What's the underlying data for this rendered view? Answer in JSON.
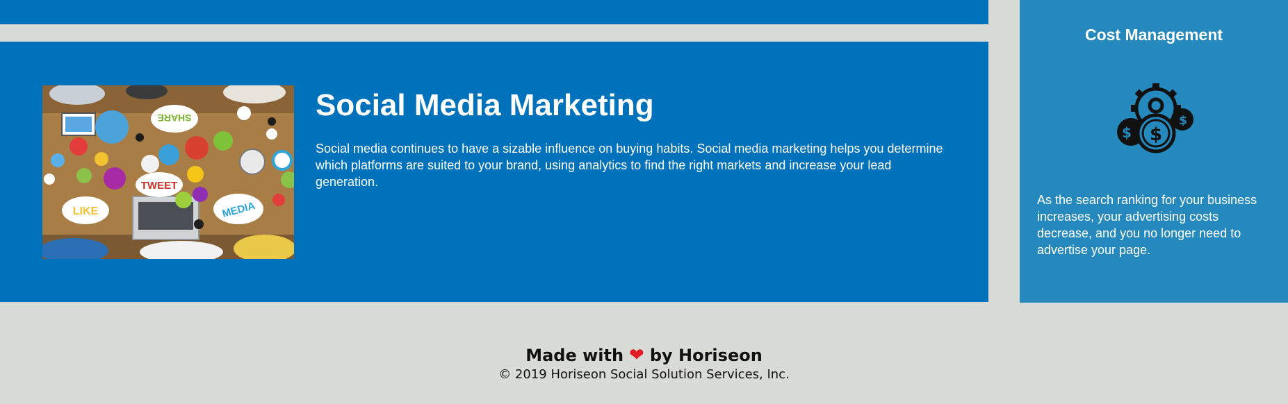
{
  "section": {
    "title": "Social Media Marketing",
    "text": "Social media continues to have a sizable influence on buying habits. Social media marketing helps you determine which platforms are suited to your brand, using analytics to find the right markets and increase your lead generation.",
    "image_labels": {
      "share": "SHARE",
      "tweet": "TWEET",
      "like": "LIKE",
      "media": "MEDIA"
    }
  },
  "sidebar_card": {
    "title": "Cost Management",
    "icon": "cost-management-icon",
    "text": "As the search ranking for your business increases, your advertising costs decrease, and you no longer need to advertise your page."
  },
  "footer": {
    "made_prefix": "Made with",
    "made_suffix": "by Horiseon",
    "heart": "❤",
    "copyright": "© 2019 Horiseon Social Solution Services, Inc."
  },
  "colors": {
    "page_background": "#d9dbd7",
    "section_blue": "#0072bb",
    "card_blue": "#2589bd",
    "text_light": "#ffffff",
    "heart_red": "#e01b24"
  }
}
